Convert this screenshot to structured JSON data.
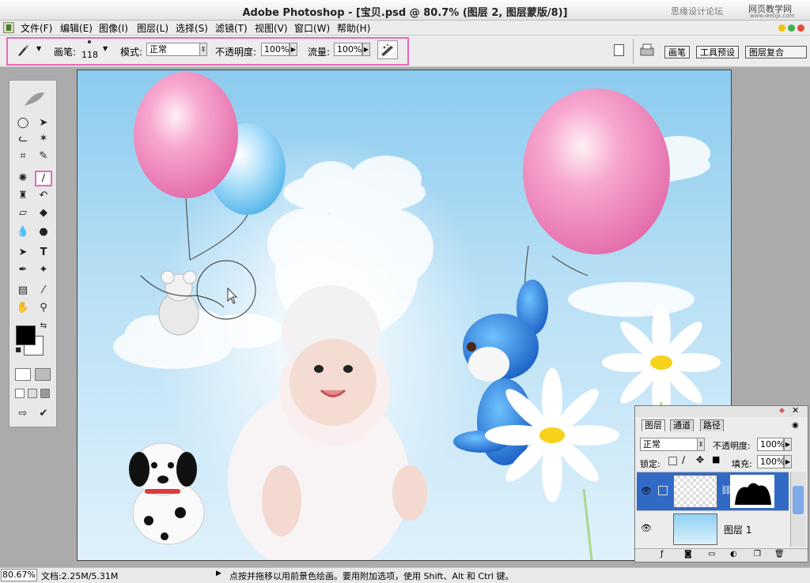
{
  "window": {
    "title": "Adobe Photoshop - [宝贝.psd @ 80.7% (图层 2, 图层蒙版/8)]",
    "watermark": "思缘设计论坛",
    "watermark2": "网页教学网",
    "watermark3": "www.webjx.com"
  },
  "menu": [
    "文件(F)",
    "编辑(E)",
    "图像(I)",
    "图层(L)",
    "选择(S)",
    "滤镜(T)",
    "视图(V)",
    "窗口(W)",
    "帮助(H)"
  ],
  "options": {
    "brush_label": "画笔:",
    "brush_size": "118",
    "mode_label": "模式:",
    "mode_value": "正常",
    "opacity_label": "不透明度:",
    "opacity_value": "100%",
    "flow_label": "流量:",
    "flow_value": "100%"
  },
  "palette_tabs": [
    "画笔",
    "工具预设",
    "图层复合"
  ],
  "toolbox_icons": [
    "feather-icon",
    "marquee-icon",
    "move-icon",
    "lasso-icon",
    "magic-wand-icon",
    "crop-icon",
    "slice-icon",
    "healing-icon",
    "brush-icon",
    "stamp-icon",
    "history-brush-icon",
    "eraser-icon",
    "bucket-icon",
    "blur-icon",
    "dodge-icon",
    "path-select-icon",
    "type-icon",
    "pen-icon",
    "shape-icon",
    "notes-icon",
    "eyedropper-icon",
    "hand-icon",
    "zoom-icon"
  ],
  "colors": {
    "foreground": "#000000",
    "background": "#ffffff",
    "highlight": "#e66ab6",
    "selection": "#316ac5"
  },
  "layers_panel": {
    "tabs": [
      "图层",
      "通道",
      "路径"
    ],
    "blend_mode": "正常",
    "opacity_label": "不透明度:",
    "opacity_value": "100%",
    "lock_label": "锁定:",
    "fill_label": "填充:",
    "fill_value": "100%",
    "layers": [
      {
        "name": "",
        "selected": true,
        "has_mask": true
      },
      {
        "name": "图层 1",
        "selected": false,
        "has_mask": false
      }
    ]
  },
  "status": {
    "zoom": "80.67%",
    "doc": "文档:2.25M/5.31M",
    "hint": "点按并拖移以用前景色绘画。要用附加选项，使用 Shift、Alt 和 Ctrl 键。"
  }
}
